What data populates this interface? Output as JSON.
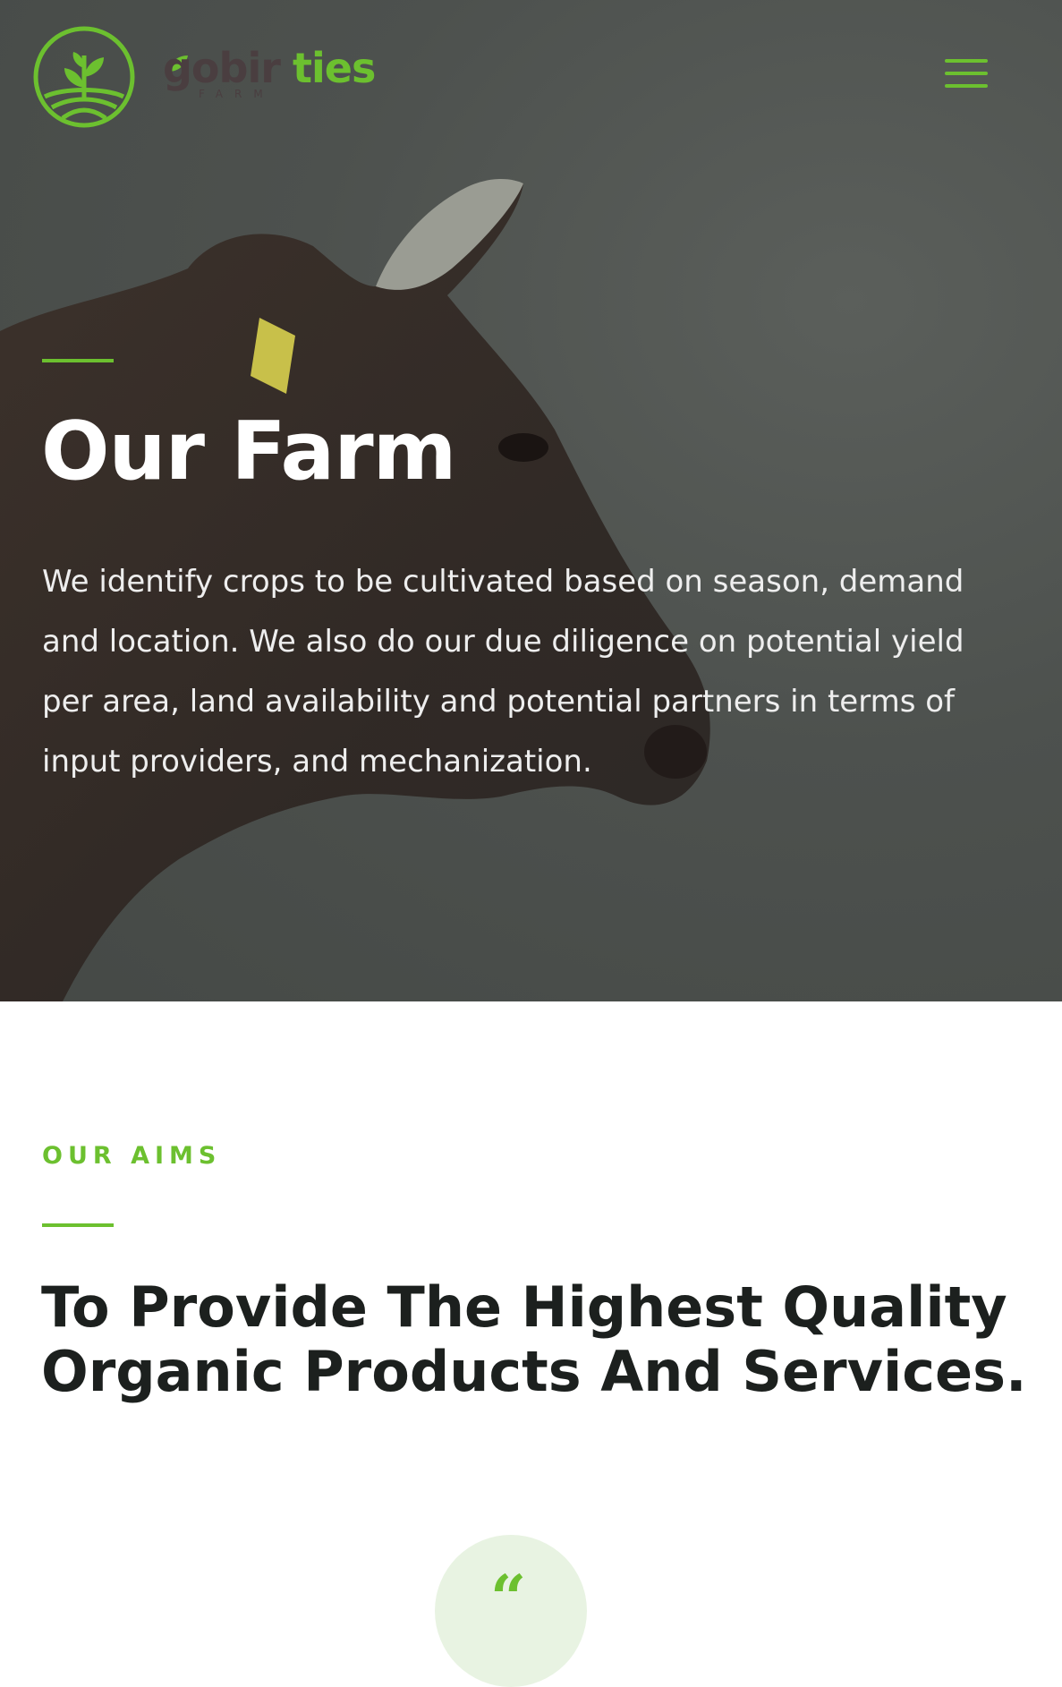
{
  "brand": {
    "name_dark": "gobir",
    "name_green": "ties",
    "sub": "FARM",
    "accent": "#6cc02f"
  },
  "header": {
    "menu_icon": "hamburger-icon"
  },
  "hero": {
    "title": "Our Farm",
    "text": "We identify crops to be cultivated based on season, demand and location. We also do our due diligence on potential yield per area, land availability and potential partners in terms of input providers, and mechanization."
  },
  "aims": {
    "eyebrow": "OUR AIMS",
    "title": "To Provide The Highest Quality Organic Products And Services.",
    "quote_icon": "quote-icon",
    "quote_glyph": "“"
  }
}
